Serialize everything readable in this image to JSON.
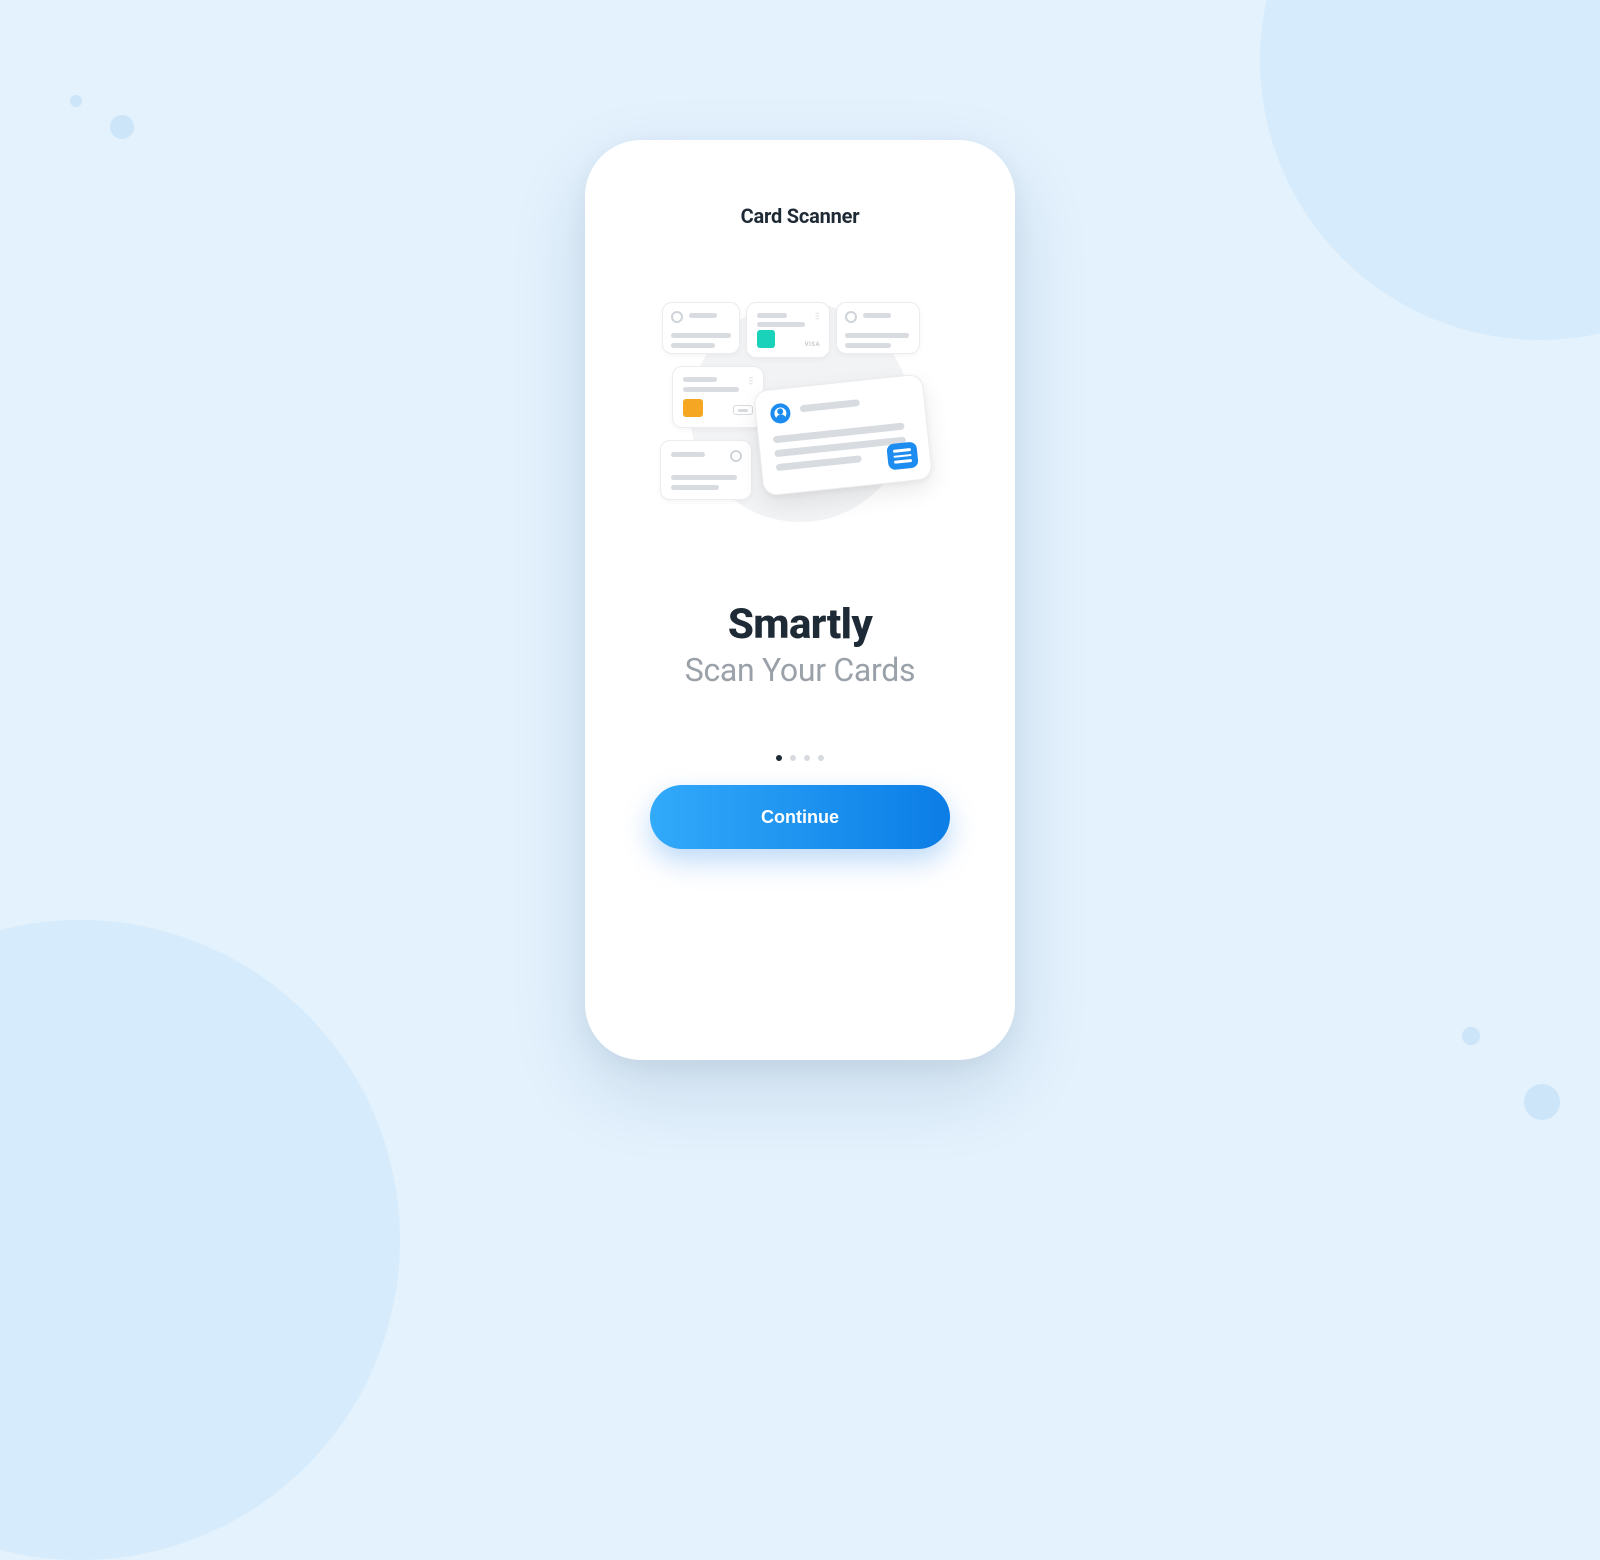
{
  "header": {
    "title": "Card Scanner"
  },
  "onboarding": {
    "headline_bold": "Smartly",
    "headline_sub": "Scan Your Cards",
    "page_count": 4,
    "active_page_index": 0
  },
  "cta": {
    "continue_label": "Continue"
  },
  "illustration": {
    "cards": [
      {
        "id": "A",
        "type": "contact"
      },
      {
        "id": "B",
        "type": "credit-card",
        "accent": "#1AD1B9",
        "brand": "VISA"
      },
      {
        "id": "C",
        "type": "contact"
      },
      {
        "id": "D",
        "type": "credit-card",
        "accent": "#F5A623"
      },
      {
        "id": "E",
        "type": "contact"
      },
      {
        "id": "F",
        "type": "business-card",
        "primary": true,
        "accent": "#1C8CF0"
      }
    ]
  },
  "colors": {
    "page_bg": "#E3F2FD",
    "button_gradient_start": "#32AAFA",
    "button_gradient_end": "#0B7DE6",
    "text_primary": "#1E2A35",
    "text_muted": "#9AA1A9"
  }
}
